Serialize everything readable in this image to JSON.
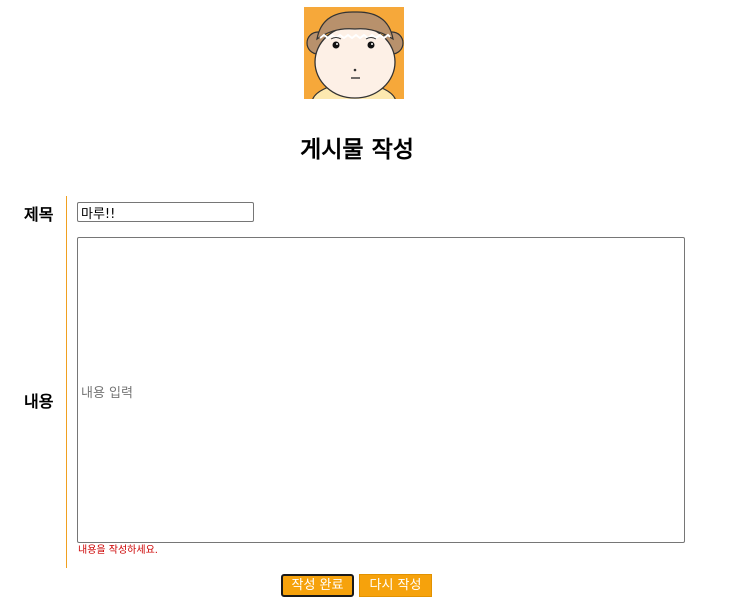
{
  "page": {
    "title": "게시물 작성"
  },
  "avatar": {
    "icon": "character-avatar-icon",
    "background": "#f6a83a"
  },
  "form": {
    "title_label": "제목",
    "title_value": "마루!!",
    "content_label": "내용",
    "content_placeholder": "내용 입력",
    "content_value": "",
    "error_message": "내용을 작성하세요.",
    "error_color": "#cc0000"
  },
  "buttons": {
    "submit_label": "작성 완료",
    "reset_label": "다시 작성",
    "accent": "#f6a20c"
  }
}
